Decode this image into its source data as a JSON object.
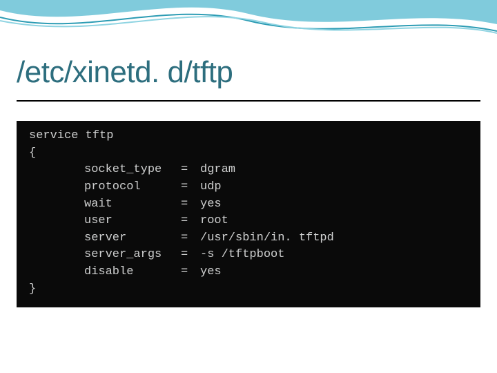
{
  "title": "/etc/xinetd. d/tftp",
  "code": {
    "header": "service tftp",
    "open": "{",
    "close": "}",
    "entries": [
      {
        "key": "socket_type",
        "eq": "=",
        "value": "dgram"
      },
      {
        "key": "protocol",
        "eq": "=",
        "value": "udp"
      },
      {
        "key": "wait",
        "eq": "=",
        "value": "yes"
      },
      {
        "key": "user",
        "eq": "=",
        "value": "root"
      },
      {
        "key": "server",
        "eq": "=",
        "value": "/usr/sbin/in. tftpd"
      },
      {
        "key": "server_args",
        "eq": "=",
        "value": "-s /tftpboot"
      },
      {
        "key": "disable",
        "eq": "=",
        "value": "yes"
      }
    ]
  }
}
